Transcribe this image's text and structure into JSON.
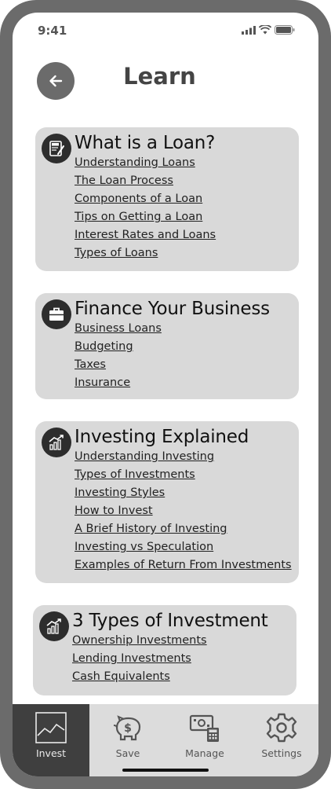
{
  "status_bar": {
    "time": "9:41"
  },
  "header": {
    "title": "Learn"
  },
  "sections": [
    {
      "title": "What is a Loan?",
      "icon": "loan-document-icon",
      "links": [
        "Understanding Loans",
        "The Loan Process",
        "Components of a Loan",
        "Tips on Getting a Loan",
        "Interest Rates and Loans",
        "Types of Loans"
      ]
    },
    {
      "title": "Finance Your Business",
      "icon": "briefcase-icon",
      "links": [
        "Business Loans",
        "Budgeting",
        "Taxes",
        "Insurance"
      ]
    },
    {
      "title": "Investing Explained",
      "icon": "growth-chart-icon",
      "links": [
        "Understanding Investing",
        "Types of Investments",
        "Investing Styles",
        "How to Invest",
        "A Brief History of Investing",
        "Investing vs Speculation",
        "Examples of Return From Investments"
      ]
    },
    {
      "title": "3 Types of Investment",
      "icon": "growth-chart-icon",
      "links": [
        "Ownership Investments",
        "Lending Investments",
        "Cash Equivalents"
      ]
    }
  ],
  "tabbar": {
    "items": [
      {
        "label": "Invest",
        "icon": "line-chart-icon",
        "active": true
      },
      {
        "label": "Save",
        "icon": "piggy-bank-icon",
        "active": false
      },
      {
        "label": "Manage",
        "icon": "money-calculator-icon",
        "active": false
      },
      {
        "label": "Settings",
        "icon": "gear-icon",
        "active": false
      }
    ]
  },
  "colors": {
    "frame": "#6b6b6b",
    "card": "#d9d9d9",
    "active_tab": "#3f3f3f",
    "tabbar": "#dcdcdc"
  }
}
